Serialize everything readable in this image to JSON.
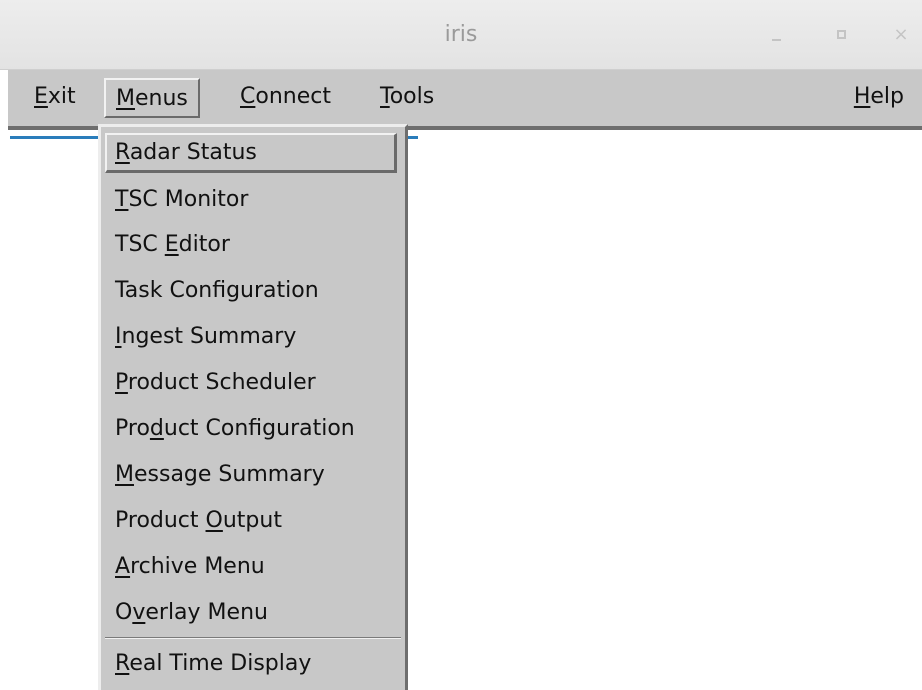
{
  "window": {
    "title": "iris",
    "minimize_glyph": "",
    "maximize_glyph": "",
    "close_glyph": "×"
  },
  "menubar": {
    "items": [
      {
        "pre": "",
        "key": "E",
        "post": "xit"
      },
      {
        "pre": "",
        "key": "M",
        "post": "enus"
      },
      {
        "pre": "",
        "key": "C",
        "post": "onnect"
      },
      {
        "pre": "",
        "key": "T",
        "post": "ools"
      },
      {
        "pre": "",
        "key": "H",
        "post": "elp"
      }
    ]
  },
  "menus_dropdown": {
    "items": [
      {
        "pre": "",
        "key": "R",
        "post": "adar Status"
      },
      {
        "pre": "",
        "key": "T",
        "post": "SC Monitor"
      },
      {
        "pre": "TSC ",
        "key": "E",
        "post": "ditor"
      },
      {
        "pre": "Task Configuration",
        "key": "",
        "post": ""
      },
      {
        "pre": "",
        "key": "I",
        "post": "ngest Summary"
      },
      {
        "pre": "",
        "key": "P",
        "post": "roduct Scheduler"
      },
      {
        "pre": "Pro",
        "key": "d",
        "post": "uct Configuration"
      },
      {
        "pre": "",
        "key": "M",
        "post": "essage Summary"
      },
      {
        "pre": "Product ",
        "key": "O",
        "post": "utput"
      },
      {
        "pre": "",
        "key": "A",
        "post": "rchive Menu"
      },
      {
        "pre": "O",
        "key": "v",
        "post": "erlay Menu"
      },
      {
        "pre": "",
        "key": "R",
        "post": "eal Time Display"
      }
    ]
  },
  "colors": {
    "menu_bg": "#c8c8c8",
    "titlebar_bg": "#e6e6e6",
    "accent_line": "#2a7dbb"
  }
}
